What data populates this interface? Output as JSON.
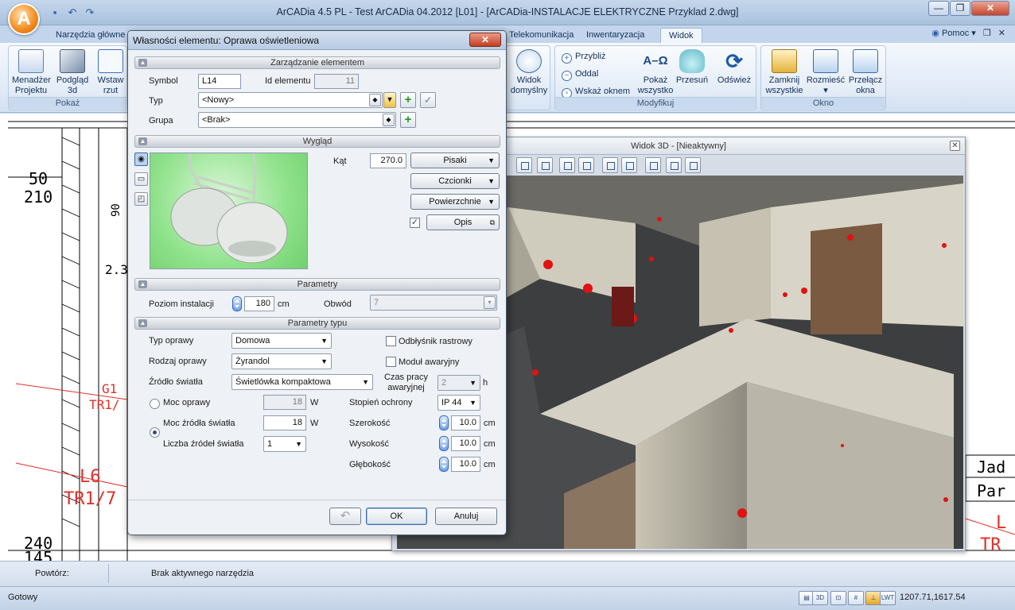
{
  "window": {
    "title": "ArCADia 4.5 PL - Test ArCADia 04.2012 [L01] - [ArCADia-INSTALACJE ELEKTRYCZNE Przyklad 2.dwg]",
    "logo_letter": "A",
    "controls": {
      "minimize": "—",
      "restore": "❐",
      "close": "✕"
    }
  },
  "ribbon_tabs": [
    {
      "label": "Narzędzia główne"
    },
    {
      "label": "Telekomunikacja"
    },
    {
      "label": "Inwentaryzacja"
    },
    {
      "label": "Widok"
    }
  ],
  "help": {
    "label": "Pomoc",
    "restore": "❐",
    "close": "✕"
  },
  "ribbon": {
    "left_buttons": [
      {
        "label": "Menadżer\nProjektu",
        "icon": "project-manager-icon"
      },
      {
        "label": "Podgląd\n3d",
        "icon": "preview-3d-icon"
      },
      {
        "label": "Wstaw\nrzut",
        "icon": "insert-plan-icon"
      }
    ],
    "left_group_label": "Pokaż",
    "view_buttons": [
      {
        "label": "Widok\ndomyślny",
        "icon": "default-view-icon"
      }
    ],
    "modify_small": [
      {
        "label": "Przybliż",
        "icon": "zoom-in-icon"
      },
      {
        "label": "Oddal",
        "icon": "zoom-out-icon"
      },
      {
        "label": "Wskaż oknem",
        "icon": "zoom-window-icon"
      }
    ],
    "modify_buttons": [
      {
        "label": "Pokaż\nwszystko",
        "icon": "zoom-all-icon"
      },
      {
        "label": "Przesuń",
        "icon": "pan-hand-icon"
      },
      {
        "label": "Odśwież",
        "icon": "refresh-icon"
      }
    ],
    "modify_group_label": "Modyfikuj",
    "window_buttons": [
      {
        "label": "Zamknij\nwszystkie",
        "icon": "close-all-icon"
      },
      {
        "label": "Rozmieść",
        "icon": "arrange-icon"
      },
      {
        "label": "Przełącz\nokna",
        "icon": "switch-windows-icon"
      }
    ],
    "window_group_label": "Okno"
  },
  "drawing": {
    "labels": [
      "50",
      "210",
      "G1",
      "TR1/",
      "L6",
      "TR1/7",
      "240",
      "145",
      "Jad",
      "Par",
      "L",
      "TR",
      "2.3",
      "90"
    ],
    "accent_red": "#e0302a"
  },
  "view3d": {
    "title": "Widok 3D - [Nieaktywny]",
    "close": "✕"
  },
  "dialog": {
    "title": "Własności elementu: Oprawa oświetleniowa",
    "close": "✕",
    "sections": {
      "manage": "Zarządzanie elementem",
      "look": "Wygląd",
      "params": "Parametry",
      "type_params": "Parametry typu"
    },
    "symbol": {
      "label": "Symbol",
      "value": "L14"
    },
    "element_id": {
      "label": "Id elementu",
      "value": "11"
    },
    "type": {
      "label": "Typ",
      "value": "<Nowy>"
    },
    "group": {
      "label": "Grupa",
      "value": "<Brak>"
    },
    "angle": {
      "label": "Kąt",
      "value": "270.0"
    },
    "look_buttons": {
      "pens": "Pisaki",
      "fonts": "Czcionki",
      "surfaces": "Powierzchnie",
      "description": "Opis"
    },
    "description_checked": true,
    "install_level": {
      "label": "Poziom instalacji",
      "value": "180",
      "unit": "cm"
    },
    "circuit": {
      "label": "Obwód",
      "value": "7"
    },
    "fixture_type": {
      "label": "Typ oprawy",
      "value": "Domowa"
    },
    "fixture_kind": {
      "label": "Rodzaj oprawy",
      "value": "Żyrandol"
    },
    "light_source": {
      "label": "Źródło światła",
      "value": "Świetlówka kompaktowa"
    },
    "grid_reflector": {
      "label": "Odbłyśnik rastrowy",
      "checked": false
    },
    "emergency_module": {
      "label": "Moduł awaryjny",
      "checked": false
    },
    "emergency_time": {
      "label": "Czas pracy\nawaryjnej",
      "value": "2",
      "unit": "h"
    },
    "fixture_power": {
      "label": "Moc oprawy",
      "value": "18",
      "unit": "W",
      "selected": false
    },
    "source_power": {
      "label": "Moc źródła światła",
      "value": "18",
      "unit": "W",
      "selected": true
    },
    "source_count": {
      "label": "Liczba źródeł światła",
      "value": "1"
    },
    "protection": {
      "label": "Stopień ochrony",
      "value": "IP 44"
    },
    "width": {
      "label": "Szerokość",
      "value": "10.0",
      "unit": "cm"
    },
    "height": {
      "label": "Wysokość",
      "value": "10.0",
      "unit": "cm"
    },
    "depth": {
      "label": "Głębokość",
      "value": "10.0",
      "unit": "cm"
    },
    "buttons": {
      "undo": "↶",
      "ok": "OK",
      "cancel": "Anuluj"
    }
  },
  "command_bar": {
    "repeat_label": "Powtórz:",
    "status": "Brak aktywnego narzędzia"
  },
  "status_bar": {
    "state": "Gotowy",
    "coords": "1207.71,1617.54",
    "lwt": "LWT"
  }
}
